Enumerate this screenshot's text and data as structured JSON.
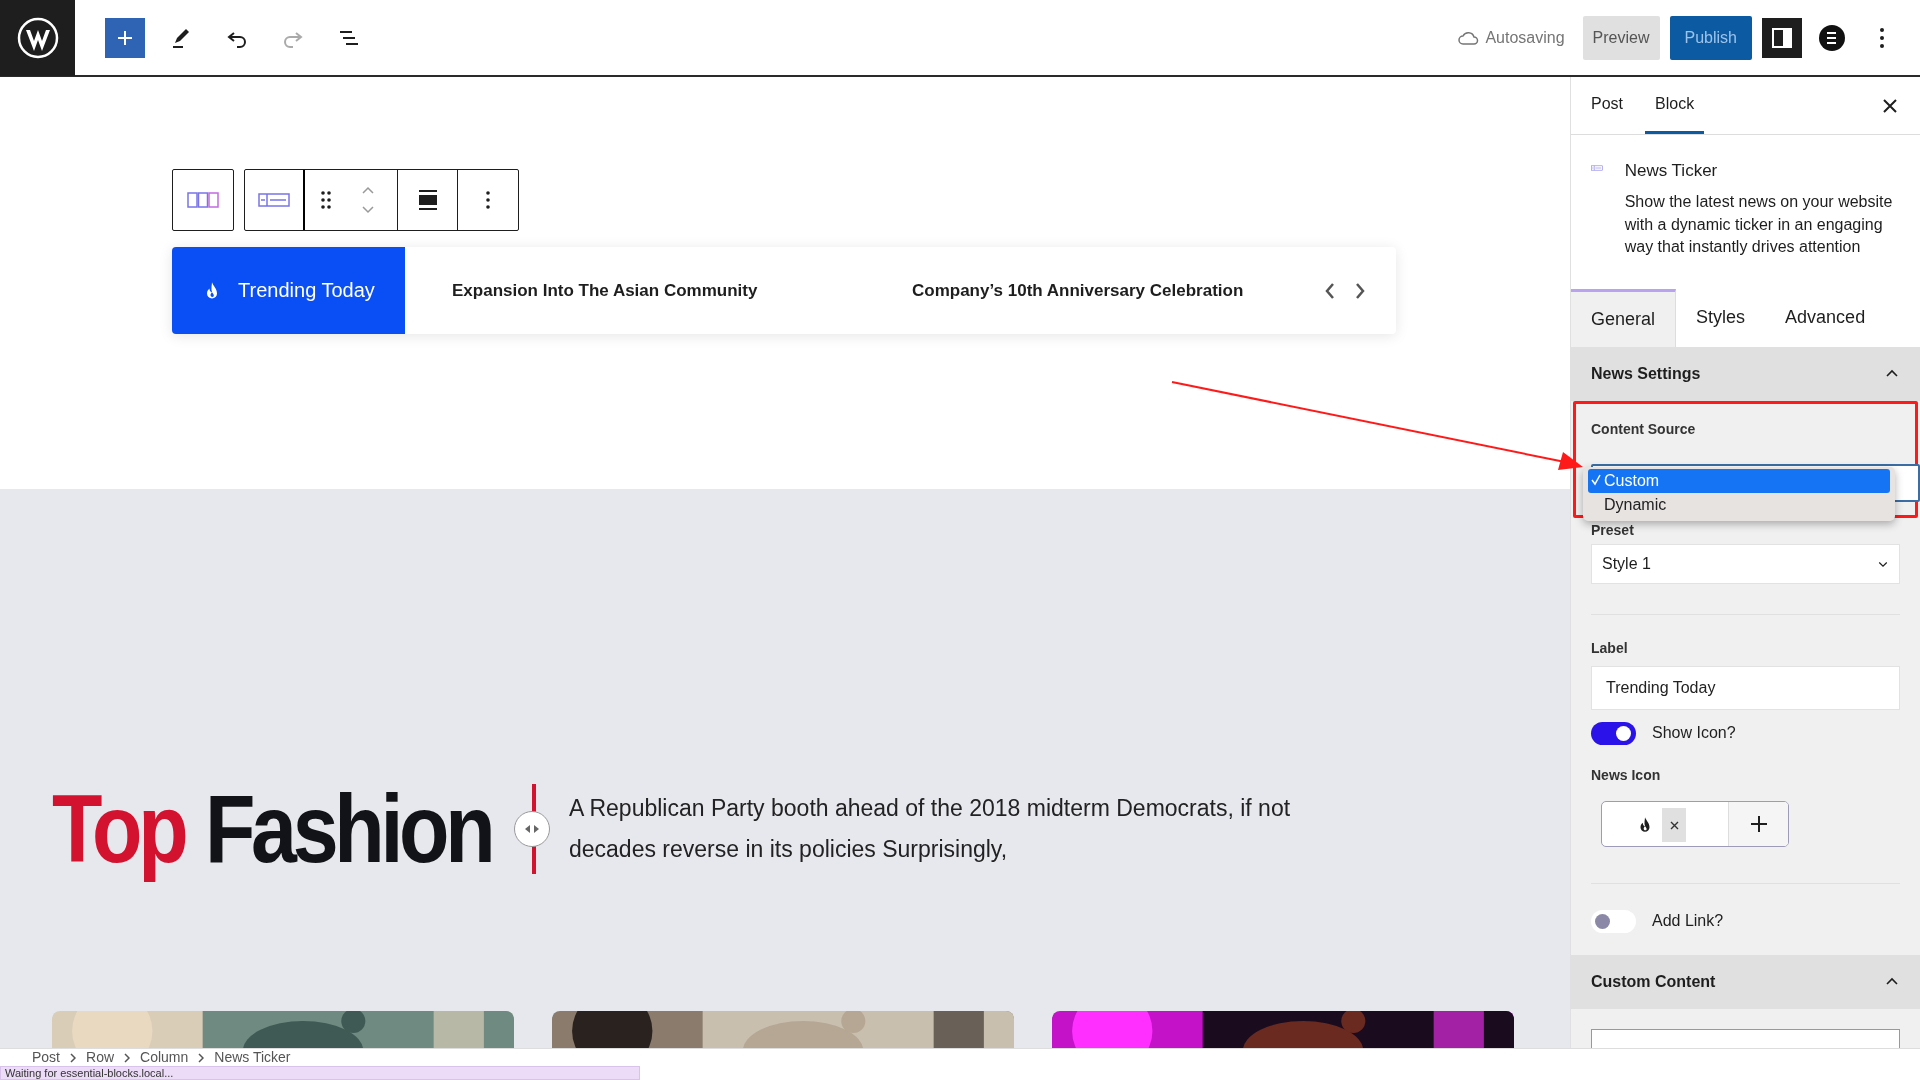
{
  "topbar": {
    "status": "Autosaving",
    "buttons": [
      {
        "label": "Preview",
        "kind": "secondary"
      },
      {
        "label": "Publish",
        "kind": "primary"
      }
    ]
  },
  "ticker": {
    "label": "Trending Today",
    "show_icon": true,
    "items": [
      "Expansion Into The Asian Community",
      "Company’s 10th Anniversary Celebration"
    ]
  },
  "hero": {
    "title_parts": [
      {
        "text": "Top",
        "color": "#d3122f"
      },
      {
        "text": "Fashion",
        "color": "#111318"
      }
    ],
    "text": "A Republican Party booth ahead of the 2018 midterm Democrats, if not decades reverse in its policies Surprisingly,"
  },
  "breadcrumb": [
    "Post",
    "Row",
    "Column",
    "News Ticker"
  ],
  "status_tip": "Waiting for essential-blocks.local...",
  "sidebar": {
    "tabs": [
      {
        "label": "Post",
        "selected": false
      },
      {
        "label": "Block",
        "selected": true
      }
    ],
    "block": {
      "name": "News Ticker",
      "description": "Show the latest news on your website with a dynamic ticker in an engaging way that instantly drives attention"
    },
    "panel_tabs": [
      {
        "label": "General",
        "selected": true
      },
      {
        "label": "Styles",
        "selected": false
      },
      {
        "label": "Advanced",
        "selected": false
      }
    ],
    "news_settings": {
      "title": "News Settings",
      "expanded": true,
      "content_source": {
        "label": "Content Source",
        "options": [
          {
            "label": "Custom",
            "selected": true
          },
          {
            "label": "Dynamic",
            "selected": false
          }
        ]
      },
      "preset": {
        "label": "Preset",
        "value": "Style 1"
      },
      "label_field": {
        "label": "Label",
        "value": "Trending Today"
      },
      "show_icon": {
        "label": "Show Icon?",
        "on": true
      },
      "news_icon": {
        "label": "News Icon"
      },
      "add_link": {
        "label": "Add Link?",
        "on": false
      }
    },
    "custom_content": {
      "title": "Custom Content",
      "expanded": true
    }
  }
}
